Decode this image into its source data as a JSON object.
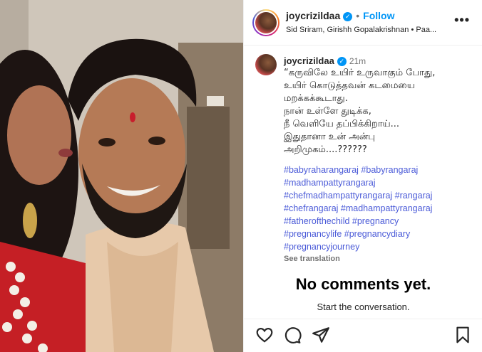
{
  "post": {
    "username": "joycrizildaa",
    "follow_label": "Follow",
    "audio": "Sid Sriram, Girishh Gopalakrishnan • Paa...",
    "more_label": "•••"
  },
  "caption": {
    "username": "joycrizildaa",
    "time": "21m",
    "text": "“கருவிலே உயிர் உருவாகும் போது,\nஉயிர் கொடுத்தவன் கடமையை\nமறக்கக்கூடாது.\nநான் உள்ளே துடிக்க,\nநீ வெளியே தப்பிக்கிறாய்...\nஇதுதானா உன் அன்பு\nஅறிமுகம்....??????",
    "hashtag_lines": [
      "#babyraharangaraj #babyrangaraj",
      "#madhampattyrangaraj",
      "#chefmadhampattyrangaraj #rangaraj",
      "#chefrangaraj #madhampattyrangaraj",
      "#fatherofthechild #pregnancy",
      "#pregnancylife #pregnancydiary",
      "#pregnancyjourney"
    ],
    "see_translation": "See translation"
  },
  "comments": {
    "empty_title": "No comments yet.",
    "empty_sub": "Start the conversation."
  },
  "icons": [
    "heart-icon",
    "comment-icon",
    "share-icon",
    "bookmark-icon",
    "verified-icon",
    "more-icon"
  ],
  "colors": {
    "accent": "#0095f6",
    "hashtag": "#4b5bd8",
    "muted": "#737373"
  }
}
